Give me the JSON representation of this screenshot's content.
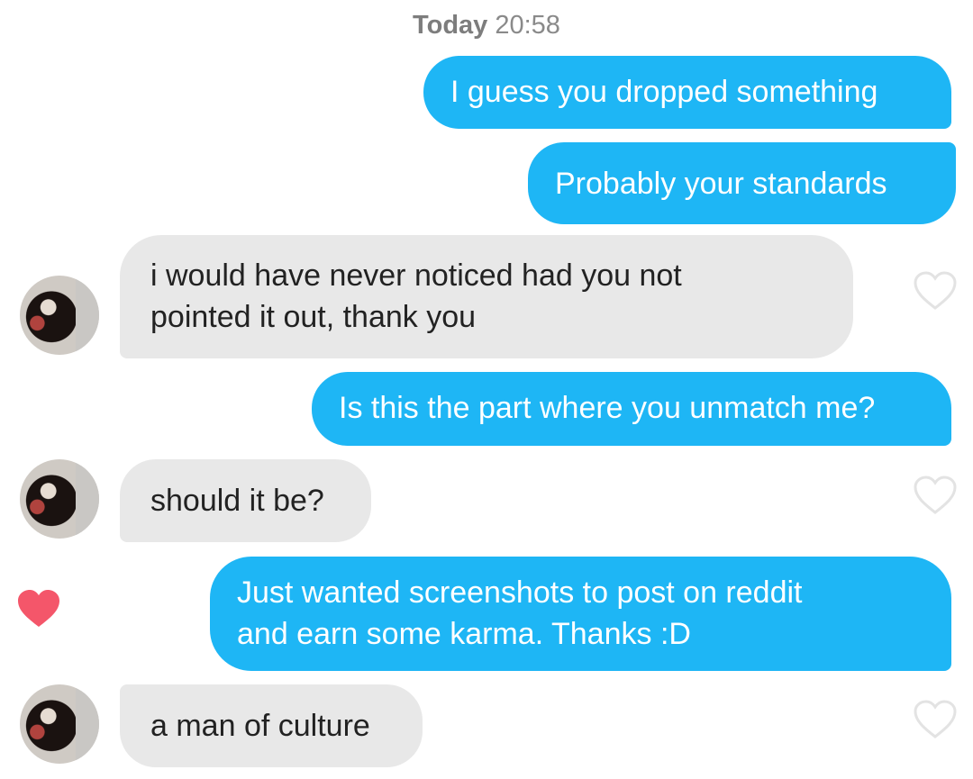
{
  "timestamp": {
    "day": "Today",
    "time": "20:58"
  },
  "messages": [
    {
      "direction": "sent",
      "text": "I guess you dropped something"
    },
    {
      "direction": "sent",
      "text": "Probably your standards"
    },
    {
      "direction": "received",
      "lines": [
        "i would have never noticed had you not",
        "pointed it out, thank you"
      ]
    },
    {
      "direction": "sent",
      "text": "Is this the part where you unmatch me?"
    },
    {
      "direction": "received",
      "text": "should it be?"
    },
    {
      "direction": "sent",
      "lines": [
        "Just wanted screenshots to post on reddit",
        "and earn some karma. Thanks :D"
      ],
      "liked": true
    },
    {
      "direction": "received",
      "text": "a man of culture"
    }
  ],
  "colors": {
    "sent_bubble": "#1eb6f5",
    "received_bubble": "#e8e8e8",
    "like_heart": "#f4566a",
    "unliked_heart_outline": "#e3e3e3"
  },
  "icons": {
    "like_icon": "heart-outline",
    "liked_icon": "heart-filled"
  }
}
